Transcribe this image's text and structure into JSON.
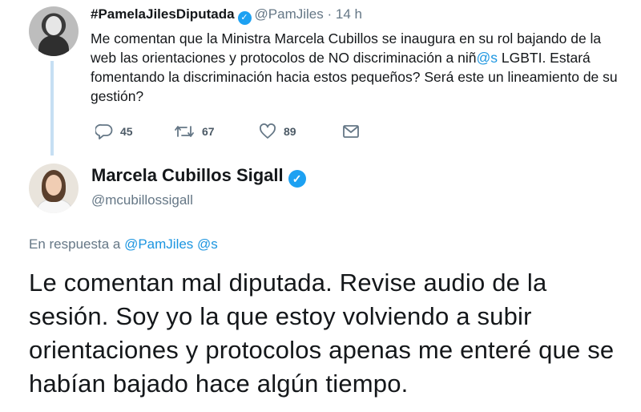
{
  "reply_tweet": {
    "display_name": "#PamelaJilesDiputada",
    "handle": "@PamJiles",
    "separator": "·",
    "time": "14 h",
    "text_part1": "Me comentan que la Ministra Marcela Cubillos se inaugura en su rol bajando de la web las orientaciones y protocolos de NO discriminación a niñ",
    "text_mention": "@s",
    "text_part2": " LGBTI. Estará fomentando la discriminación hacia estos pequeños? Será este un lineamiento de su gestión?",
    "reply_count": "45",
    "retweet_count": "67",
    "like_count": "89"
  },
  "main_tweet": {
    "display_name": "Marcela Cubillos Sigall",
    "handle": "@mcubillossigall",
    "in_reply_prefix": "En respuesta a ",
    "in_reply_mention1": "@PamJiles",
    "in_reply_mention2": "@s",
    "text": "Le comentan mal diputada. Revise audio de la sesión. Soy yo la que estoy volviendo a subir orientaciones y protocolos apenas me enteré que se habían bajado hace algún tiempo."
  },
  "colors": {
    "accent": "#1da1f2",
    "link": "#1b95e0",
    "secondary_text": "#657786",
    "thread_line": "#c6dff3"
  },
  "icons": [
    "reply-icon",
    "retweet-icon",
    "like-icon",
    "direct-message-icon",
    "verified-badge-icon"
  ]
}
